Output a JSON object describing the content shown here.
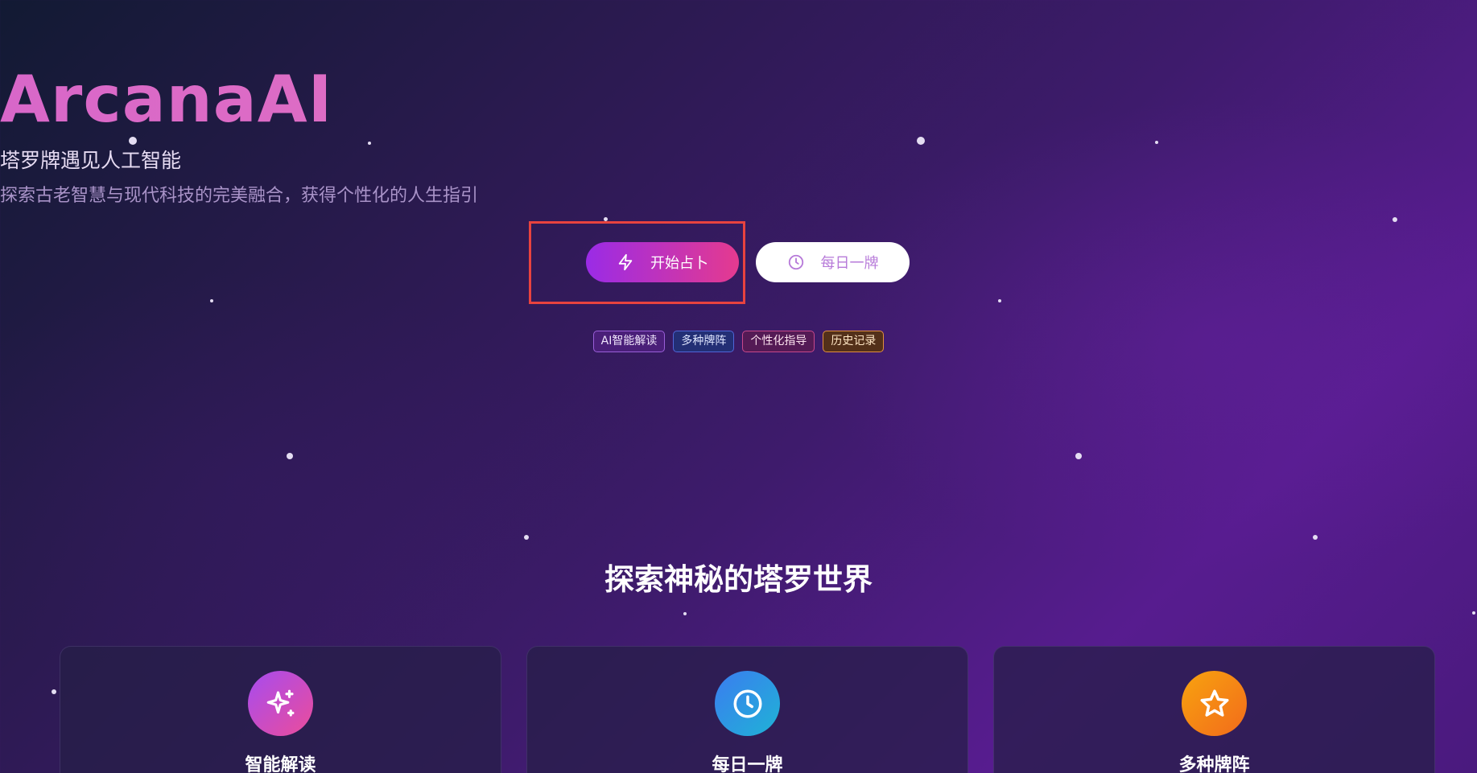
{
  "hero": {
    "title": "ArcanaAI",
    "subtitle": "塔罗牌遇见人工智能",
    "tagline": "探索古老智慧与现代科技的完美融合，获得个性化的人生指引"
  },
  "actions": {
    "start_label": "开始占卜",
    "start_icon": "lightning-icon",
    "daily_label": "每日一牌",
    "daily_icon": "clock-icon"
  },
  "tags": [
    "AI智能解读",
    "多种牌阵",
    "个性化指导",
    "历史记录"
  ],
  "features": {
    "section_title": "探索神秘的塔罗世界",
    "cards": [
      {
        "title": "智能解读",
        "icon": "sparkles-icon"
      },
      {
        "title": "每日一牌",
        "icon": "clock-icon"
      },
      {
        "title": "多种牌阵",
        "icon": "star-icon"
      }
    ]
  },
  "colors": {
    "title_gradient": [
      "#d867c9",
      "#f07eb5"
    ],
    "primary_button": [
      "#9a2be6",
      "#e53a8f"
    ],
    "highlight": "#e8433f"
  }
}
